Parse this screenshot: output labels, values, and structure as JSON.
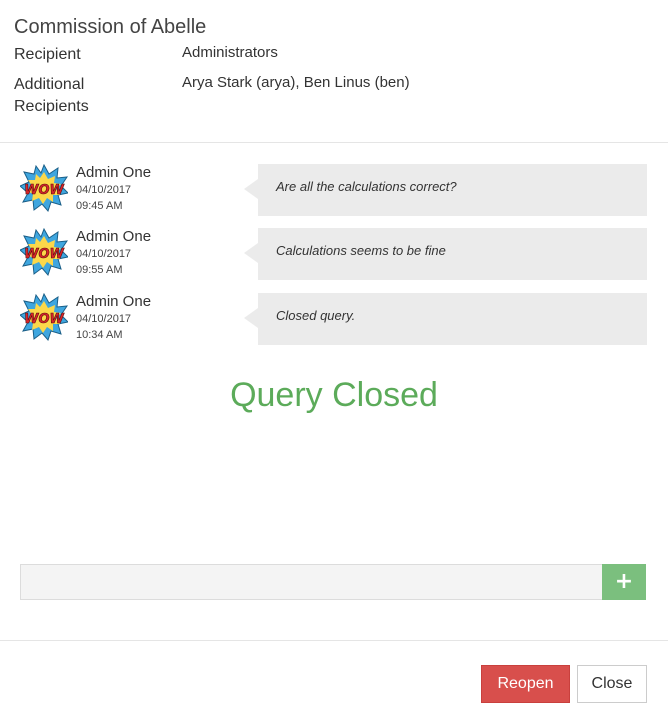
{
  "header": {
    "title": "Commission of Abelle",
    "recipient_label": "Recipient",
    "recipient_value": "Administrators",
    "additional_label_line1": "Additional",
    "additional_label_line2": "Recipients",
    "additional_value": "Arya Stark (arya), Ben Linus (ben)"
  },
  "messages": [
    {
      "author": "Admin One",
      "date": "04/10/2017",
      "time": "09:45 AM",
      "text": "Are all the calculations correct?",
      "avatar": "WOW"
    },
    {
      "author": "Admin One",
      "date": "04/10/2017",
      "time": "09:55 AM",
      "text": "Calculations seems to be fine",
      "avatar": "WOW"
    },
    {
      "author": "Admin One",
      "date": "04/10/2017",
      "time": "10:34 AM",
      "text": "Closed query.",
      "avatar": "WOW"
    }
  ],
  "status_text": "Query Closed",
  "composer": {
    "placeholder": "",
    "add_icon": "plus-icon",
    "add_label": "+"
  },
  "footer": {
    "reopen_label": "Reopen",
    "close_label": "Close"
  },
  "colors": {
    "status_green": "#5cab5a",
    "add_button": "#7bbf7e",
    "reopen_red": "#d84f4c",
    "bubble_bg": "#ebebeb"
  }
}
